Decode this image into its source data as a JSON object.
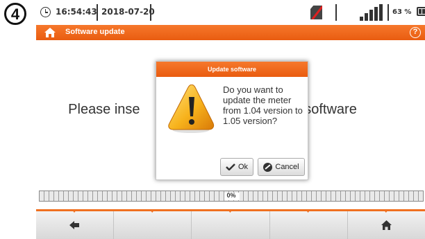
{
  "step": "4",
  "status": {
    "time": "16:54:43",
    "date": "2018-07-20",
    "battery": "63 %",
    "icons": [
      "clock-icon",
      "sd-card-disabled-icon",
      "signal-icon",
      "battery-icon"
    ]
  },
  "header": {
    "title": "Software update",
    "help": "?",
    "accent_color": "#ee6a1c"
  },
  "main": {
    "message_left": "Please inse",
    "message_right": "e software"
  },
  "dialog": {
    "title": "Update software",
    "text": "Do you want to update the meter from 1.04 version to 1.05 version?",
    "ok_label": "Ok",
    "cancel_label": "Cancel"
  },
  "progress": {
    "label": "0%",
    "value": 0
  },
  "bottom_bar": {
    "items": [
      "back-icon",
      "",
      "",
      "",
      "home-icon"
    ]
  }
}
